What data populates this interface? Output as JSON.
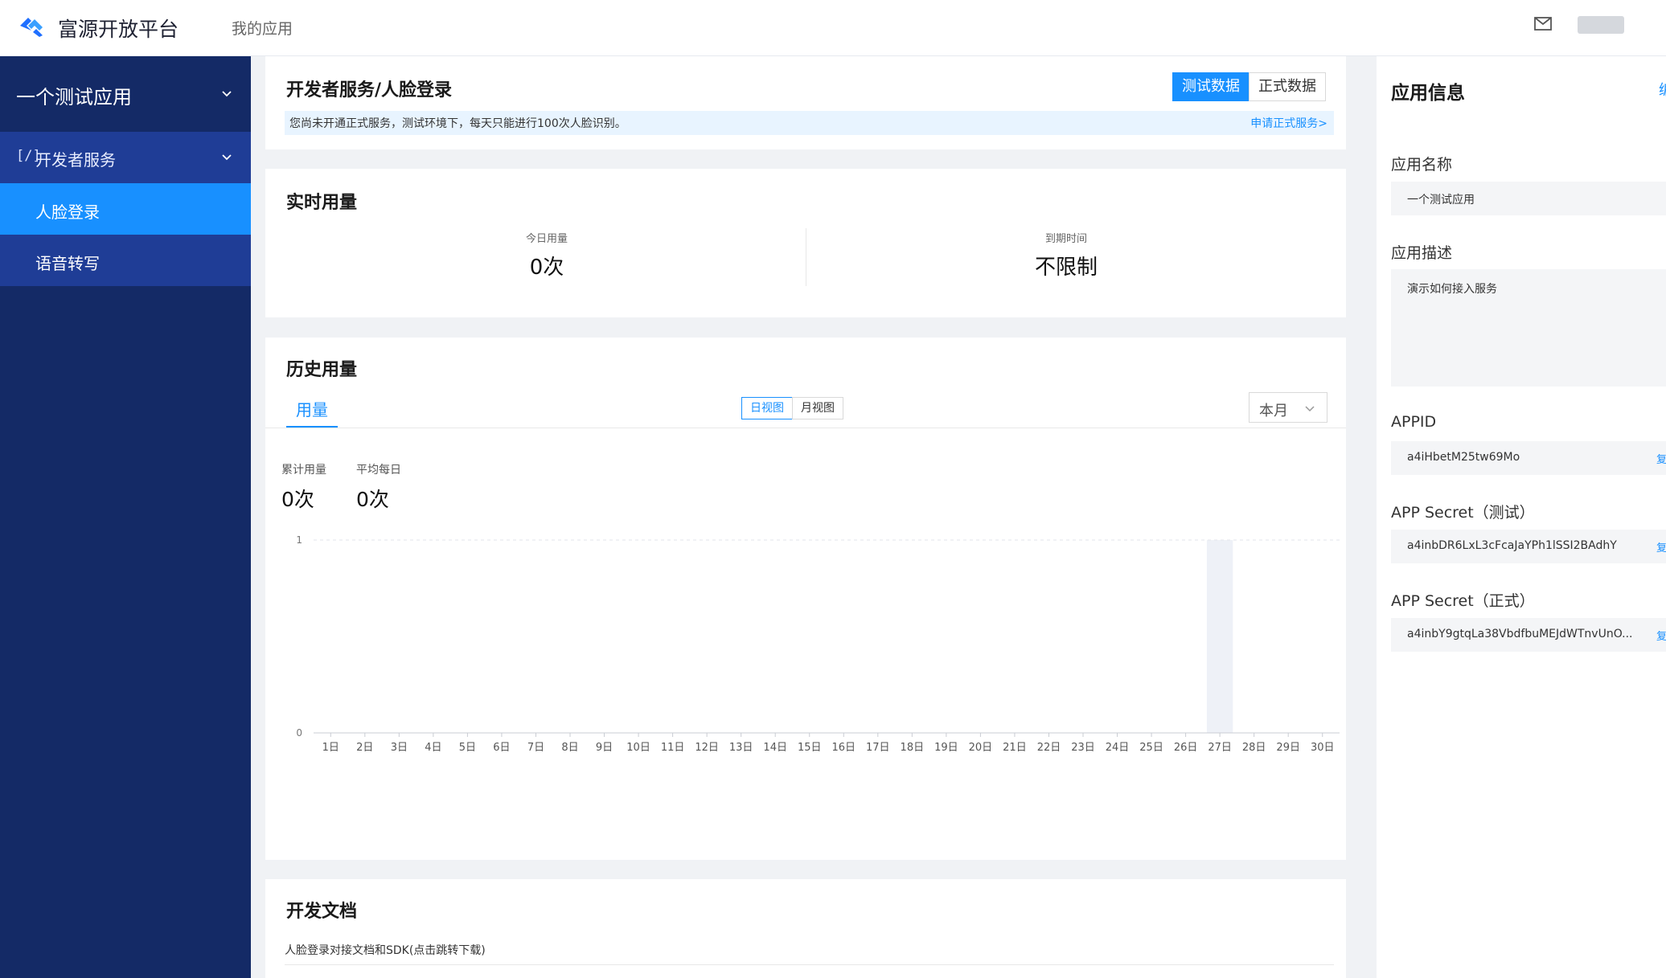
{
  "header": {
    "brand": "富源开放平台",
    "nav_item": "我的应用",
    "mail_icon": "mail-icon",
    "logo_icon": "platform-logo-icon"
  },
  "sidebar": {
    "app_name": "一个测试应用",
    "group": {
      "icon": "[/]",
      "label": "开发者服务"
    },
    "items": [
      {
        "label": "人脸登录",
        "active": true
      },
      {
        "label": "语音转写",
        "active": false
      }
    ]
  },
  "service": {
    "title": "开发者服务/人脸登录",
    "toggle": {
      "test_label": "测试数据",
      "prod_label": "正式数据",
      "selected": "测试数据"
    },
    "notice": "您尚未开通正式服务，测试环境下，每天只能进行100次人脸识别。",
    "notice_link": "申请正式服务>"
  },
  "realtime": {
    "title": "实时用量",
    "today_label": "今日用量",
    "today_value": "0次",
    "expiry_label": "到期时间",
    "expiry_value": "不限制"
  },
  "history": {
    "title": "历史用量",
    "tab": "用量",
    "view_day": "日视图",
    "view_month": "月视图",
    "selected_view": "日视图",
    "period": "本月",
    "total_label": "累计用量",
    "total_value": "0次",
    "avg_label": "平均每日",
    "avg_value": "0次"
  },
  "chart_data": {
    "type": "bar",
    "categories": [
      "1日",
      "2日",
      "3日",
      "4日",
      "5日",
      "6日",
      "7日",
      "8日",
      "9日",
      "10日",
      "11日",
      "12日",
      "13日",
      "14日",
      "15日",
      "16日",
      "17日",
      "18日",
      "19日",
      "20日",
      "21日",
      "22日",
      "23日",
      "24日",
      "25日",
      "26日",
      "27日",
      "28日",
      "29日",
      "30日"
    ],
    "values": [
      0,
      0,
      0,
      0,
      0,
      0,
      0,
      0,
      0,
      0,
      0,
      0,
      0,
      0,
      0,
      0,
      0,
      0,
      0,
      0,
      0,
      0,
      0,
      0,
      0,
      0,
      0,
      0,
      0,
      0
    ],
    "ylim": [
      0,
      1
    ],
    "y_ticks": [
      "0",
      "1"
    ],
    "highlighted_category": "27日",
    "grid": true,
    "highlight_color": "#eef1f7",
    "bar_color": "#1890ff"
  },
  "docs": {
    "title": "开发文档",
    "link": "人脸登录对接文档和SDK(点击跳转下载)"
  },
  "app_info": {
    "title": "应用信息",
    "edit_label": "编",
    "name_label": "应用名称",
    "name_value": "一个测试应用",
    "desc_label": "应用描述",
    "desc_value": "演示如何接入服务",
    "appid_label": "APPID",
    "appid_value": "a4iHbetM25tw69Mo",
    "secret_test_label": "APP Secret（测试）",
    "secret_test_value": "a4inbDR6LxL3cFcaJaYPh1lSSI2BAdhY",
    "secret_prod_label": "APP Secret（正式）",
    "secret_prod_value": "a4inbY9gtqLa38VbdfbuMEJdWTnvUnO...",
    "copy_label": "复制"
  }
}
